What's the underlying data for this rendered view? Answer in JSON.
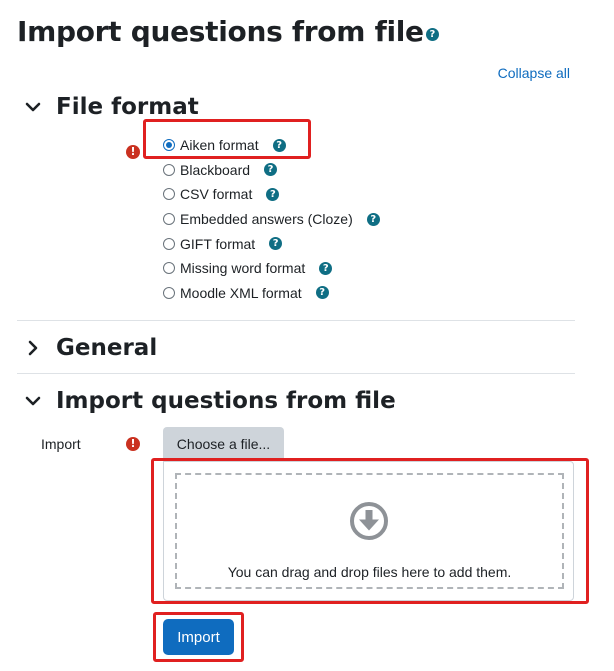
{
  "page": {
    "title": "Import questions from file",
    "help_icon": "question-circle-icon",
    "collapse_all": "Collapse all"
  },
  "sections": {
    "file_format": {
      "title": "File format",
      "expanded": true,
      "options": [
        {
          "label": "Aiken format",
          "checked": true
        },
        {
          "label": "Blackboard",
          "checked": false
        },
        {
          "label": "CSV format",
          "checked": false
        },
        {
          "label": "Embedded answers (Cloze)",
          "checked": false
        },
        {
          "label": "GIFT format",
          "checked": false
        },
        {
          "label": "Missing word format",
          "checked": false
        },
        {
          "label": "Moodle XML format",
          "checked": false
        }
      ]
    },
    "general": {
      "title": "General",
      "expanded": false
    },
    "import": {
      "title": "Import questions from file",
      "expanded": true,
      "field_label": "Import",
      "choose_button": "Choose a file...",
      "drop_text": "You can drag and drop files here to add them."
    }
  },
  "actions": {
    "import_button": "Import"
  },
  "colors": {
    "primary": "#0f6cbf",
    "help": "#0f6e84",
    "required": "#ca3120",
    "highlight": "#e02020"
  }
}
